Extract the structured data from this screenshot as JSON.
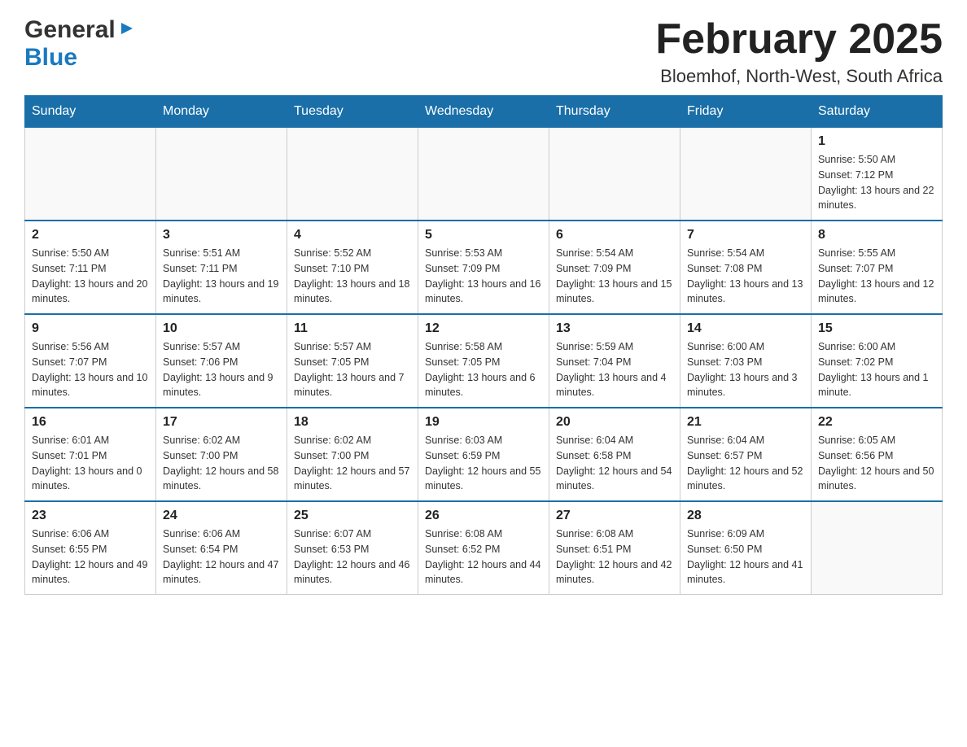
{
  "header": {
    "logo": {
      "general": "General",
      "blue": "Blue"
    },
    "title": "February 2025",
    "location": "Bloemhof, North-West, South Africa"
  },
  "calendar": {
    "days_of_week": [
      "Sunday",
      "Monday",
      "Tuesday",
      "Wednesday",
      "Thursday",
      "Friday",
      "Saturday"
    ],
    "weeks": [
      {
        "days": [
          {
            "num": "",
            "info": ""
          },
          {
            "num": "",
            "info": ""
          },
          {
            "num": "",
            "info": ""
          },
          {
            "num": "",
            "info": ""
          },
          {
            "num": "",
            "info": ""
          },
          {
            "num": "",
            "info": ""
          },
          {
            "num": "1",
            "info": "Sunrise: 5:50 AM\nSunset: 7:12 PM\nDaylight: 13 hours and 22 minutes."
          }
        ]
      },
      {
        "days": [
          {
            "num": "2",
            "info": "Sunrise: 5:50 AM\nSunset: 7:11 PM\nDaylight: 13 hours and 20 minutes."
          },
          {
            "num": "3",
            "info": "Sunrise: 5:51 AM\nSunset: 7:11 PM\nDaylight: 13 hours and 19 minutes."
          },
          {
            "num": "4",
            "info": "Sunrise: 5:52 AM\nSunset: 7:10 PM\nDaylight: 13 hours and 18 minutes."
          },
          {
            "num": "5",
            "info": "Sunrise: 5:53 AM\nSunset: 7:09 PM\nDaylight: 13 hours and 16 minutes."
          },
          {
            "num": "6",
            "info": "Sunrise: 5:54 AM\nSunset: 7:09 PM\nDaylight: 13 hours and 15 minutes."
          },
          {
            "num": "7",
            "info": "Sunrise: 5:54 AM\nSunset: 7:08 PM\nDaylight: 13 hours and 13 minutes."
          },
          {
            "num": "8",
            "info": "Sunrise: 5:55 AM\nSunset: 7:07 PM\nDaylight: 13 hours and 12 minutes."
          }
        ]
      },
      {
        "days": [
          {
            "num": "9",
            "info": "Sunrise: 5:56 AM\nSunset: 7:07 PM\nDaylight: 13 hours and 10 minutes."
          },
          {
            "num": "10",
            "info": "Sunrise: 5:57 AM\nSunset: 7:06 PM\nDaylight: 13 hours and 9 minutes."
          },
          {
            "num": "11",
            "info": "Sunrise: 5:57 AM\nSunset: 7:05 PM\nDaylight: 13 hours and 7 minutes."
          },
          {
            "num": "12",
            "info": "Sunrise: 5:58 AM\nSunset: 7:05 PM\nDaylight: 13 hours and 6 minutes."
          },
          {
            "num": "13",
            "info": "Sunrise: 5:59 AM\nSunset: 7:04 PM\nDaylight: 13 hours and 4 minutes."
          },
          {
            "num": "14",
            "info": "Sunrise: 6:00 AM\nSunset: 7:03 PM\nDaylight: 13 hours and 3 minutes."
          },
          {
            "num": "15",
            "info": "Sunrise: 6:00 AM\nSunset: 7:02 PM\nDaylight: 13 hours and 1 minute."
          }
        ]
      },
      {
        "days": [
          {
            "num": "16",
            "info": "Sunrise: 6:01 AM\nSunset: 7:01 PM\nDaylight: 13 hours and 0 minutes."
          },
          {
            "num": "17",
            "info": "Sunrise: 6:02 AM\nSunset: 7:00 PM\nDaylight: 12 hours and 58 minutes."
          },
          {
            "num": "18",
            "info": "Sunrise: 6:02 AM\nSunset: 7:00 PM\nDaylight: 12 hours and 57 minutes."
          },
          {
            "num": "19",
            "info": "Sunrise: 6:03 AM\nSunset: 6:59 PM\nDaylight: 12 hours and 55 minutes."
          },
          {
            "num": "20",
            "info": "Sunrise: 6:04 AM\nSunset: 6:58 PM\nDaylight: 12 hours and 54 minutes."
          },
          {
            "num": "21",
            "info": "Sunrise: 6:04 AM\nSunset: 6:57 PM\nDaylight: 12 hours and 52 minutes."
          },
          {
            "num": "22",
            "info": "Sunrise: 6:05 AM\nSunset: 6:56 PM\nDaylight: 12 hours and 50 minutes."
          }
        ]
      },
      {
        "days": [
          {
            "num": "23",
            "info": "Sunrise: 6:06 AM\nSunset: 6:55 PM\nDaylight: 12 hours and 49 minutes."
          },
          {
            "num": "24",
            "info": "Sunrise: 6:06 AM\nSunset: 6:54 PM\nDaylight: 12 hours and 47 minutes."
          },
          {
            "num": "25",
            "info": "Sunrise: 6:07 AM\nSunset: 6:53 PM\nDaylight: 12 hours and 46 minutes."
          },
          {
            "num": "26",
            "info": "Sunrise: 6:08 AM\nSunset: 6:52 PM\nDaylight: 12 hours and 44 minutes."
          },
          {
            "num": "27",
            "info": "Sunrise: 6:08 AM\nSunset: 6:51 PM\nDaylight: 12 hours and 42 minutes."
          },
          {
            "num": "28",
            "info": "Sunrise: 6:09 AM\nSunset: 6:50 PM\nDaylight: 12 hours and 41 minutes."
          },
          {
            "num": "",
            "info": ""
          }
        ]
      }
    ]
  }
}
